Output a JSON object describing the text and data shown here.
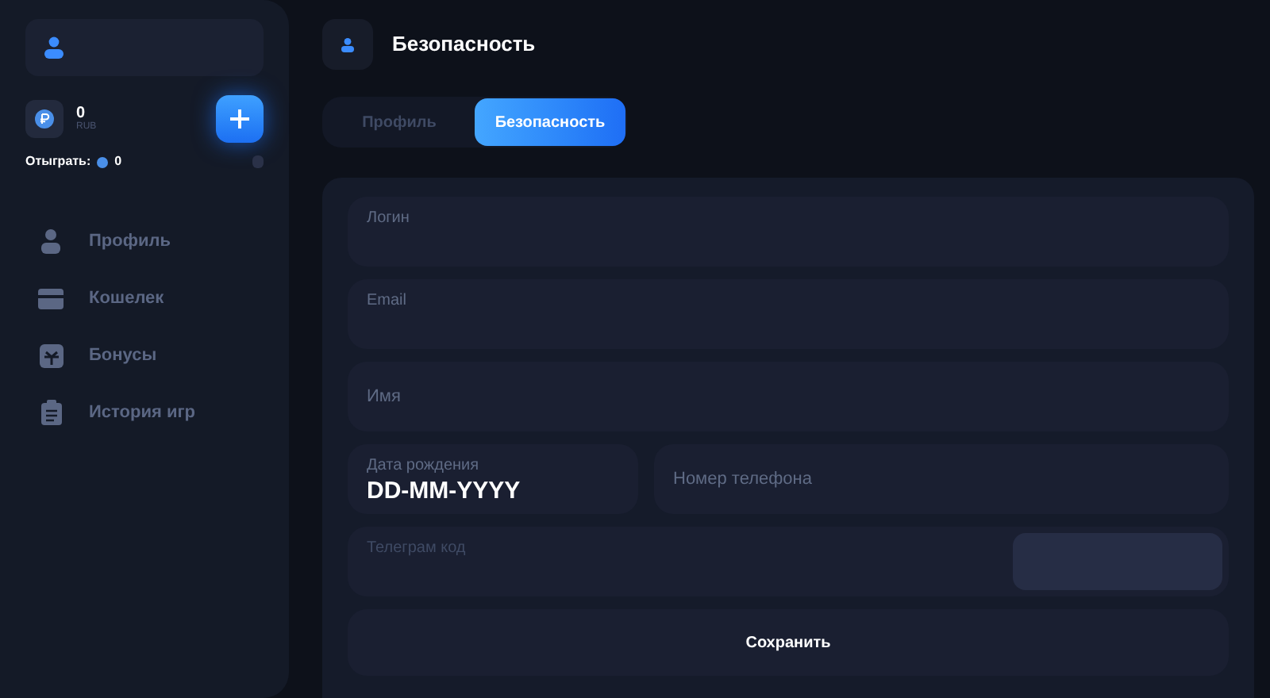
{
  "balance": {
    "amount": "0",
    "currency": "RUB",
    "wager_label": "Отыграть:",
    "wager_amount": "0"
  },
  "sidebar": {
    "items": [
      {
        "label": "Профиль"
      },
      {
        "label": "Кошелек"
      },
      {
        "label": "Бонусы"
      },
      {
        "label": "История игр"
      }
    ]
  },
  "header": {
    "title": "Безопасность"
  },
  "tabs": [
    {
      "label": "Профиль",
      "selected": false
    },
    {
      "label": "Безопасность",
      "selected": true
    }
  ],
  "form": {
    "fields": [
      {
        "kind": "labeled",
        "label": "Логин"
      },
      {
        "kind": "labeled",
        "label": "Email"
      },
      {
        "kind": "placeholder",
        "placeholder": "Имя"
      }
    ],
    "row": [
      {
        "kind": "labeled",
        "label": "Дата рождения",
        "value": "DD-MM-YYYY"
      },
      {
        "kind": "placeholder",
        "placeholder": "Номер телефона"
      }
    ],
    "telegram": {
      "label": "Телеграм код"
    },
    "save": "Сохранить"
  }
}
